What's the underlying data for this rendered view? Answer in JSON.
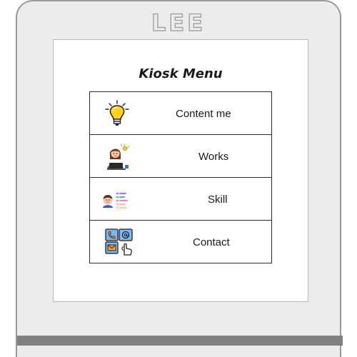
{
  "kiosk": {
    "brand": "LEE"
  },
  "screen": {
    "title": "Kiosk Menu",
    "menu": {
      "items": [
        {
          "label": "Content me",
          "icon": "light-bulb-icon"
        },
        {
          "label": "Works",
          "icon": "person-at-laptop-icon"
        },
        {
          "label": "Skill",
          "icon": "person-with-skill-bars-icon"
        },
        {
          "label": "Contact",
          "icon": "contact-icon"
        }
      ]
    }
  },
  "colors": {
    "bezel": "#ececec",
    "bezel_outline": "#9a9a9a",
    "bezel_bar": "#808080",
    "screen": "#ffffff",
    "menu_border": "#2a2a2a",
    "bulb_yellow": "#ffd21e",
    "contact_blue": "#7ab8f5"
  }
}
